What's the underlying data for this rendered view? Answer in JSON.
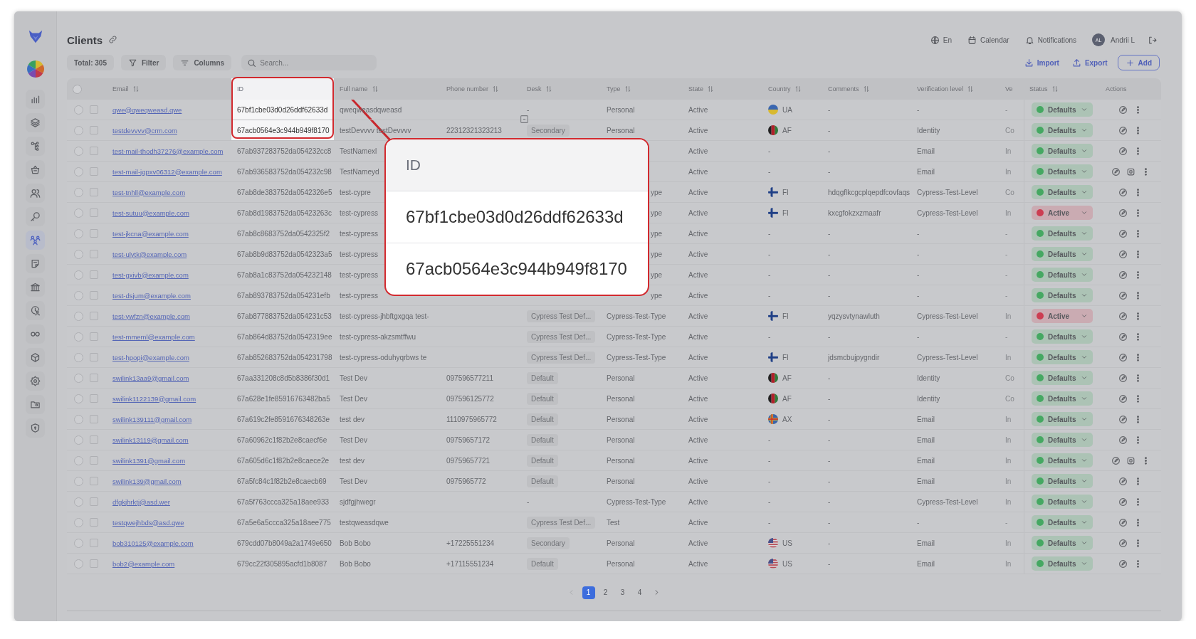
{
  "sidebar": {
    "items": [
      {
        "selected": false
      },
      {
        "selected": false
      },
      {
        "selected": false
      },
      {
        "selected": false
      },
      {
        "selected": false
      },
      {
        "selected": false
      },
      {
        "selected": true
      },
      {
        "selected": false
      },
      {
        "selected": false
      },
      {
        "selected": false
      },
      {
        "selected": false
      },
      {
        "selected": false
      },
      {
        "selected": false
      },
      {
        "selected": false
      },
      {
        "selected": false
      }
    ]
  },
  "header": {
    "title": "Clients",
    "language": "En",
    "calendar": "Calendar",
    "notifications": "Notifications",
    "avatar": "AL",
    "user": "Andrii L"
  },
  "toolbar": {
    "total": "Total: 305",
    "filter": "Filter",
    "columns": "Columns",
    "search": {
      "placeholder": "Search..."
    },
    "import": "Import",
    "export": "Export",
    "add": "Add"
  },
  "table": {
    "all_selected": false,
    "columns": [
      {
        "label": "Email",
        "sortable": true,
        "highlighted": false
      },
      {
        "label": "ID",
        "sortable": false,
        "highlighted": true
      },
      {
        "label": "Full name",
        "sortable": true,
        "highlighted": false
      },
      {
        "label": "Phone number",
        "sortable": true,
        "highlighted": false
      },
      {
        "label": "Desk",
        "sortable": true,
        "highlighted": false
      },
      {
        "label": "Type",
        "sortable": true,
        "highlighted": false
      },
      {
        "label": "State",
        "sortable": true,
        "highlighted": false
      },
      {
        "label": "Country",
        "sortable": true,
        "highlighted": false
      },
      {
        "label": "Comments",
        "sortable": true,
        "highlighted": false
      },
      {
        "label": "Verification level",
        "sortable": true,
        "highlighted": false
      },
      {
        "label": "Ve",
        "sortable": false,
        "highlighted": false
      },
      {
        "label": "Status",
        "sortable": true,
        "highlighted": false
      },
      {
        "label": "Actions",
        "sortable": false,
        "highlighted": false
      }
    ],
    "rows": [
      {
        "selected": false,
        "checked": false,
        "email": "qwe@qweqweasd.qwe",
        "id": "67bf1cbe03d0d26ddf62633d",
        "id_highlighted": true,
        "name": "qweqweasdqweasd",
        "desk": "-",
        "type": "Personal",
        "state": "Active",
        "country": "UA",
        "flag": {
          "kind": "ua"
        },
        "comments": "-",
        "verification": "-",
        "ver": "-",
        "status": {
          "label": "Defaults",
          "color": "#45a862"
        },
        "actions": [
          {
            "kind": "edit"
          },
          {
            "kind": "more"
          }
        ]
      },
      {
        "selected": false,
        "checked": false,
        "email": "testdevvvv@crm.com",
        "id": "67acb0564e3c944b949f8170",
        "id_highlighted": true,
        "name": "testDevvvv testDevvvv",
        "phone": "22312321323213",
        "desk_tag": "Secondary",
        "type": "Personal",
        "state": "Active",
        "country": "AF",
        "flag": {
          "kind": "af"
        },
        "comments": "-",
        "verification": "Identity",
        "ver": "Co",
        "status": {
          "label": "Defaults",
          "color": "#45a862"
        },
        "actions": [
          {
            "kind": "edit"
          },
          {
            "kind": "more"
          }
        ]
      },
      {
        "selected": false,
        "checked": false,
        "email": "test-mail-thodh37276@example.com",
        "id": "67ab937283752da054232cc8",
        "id_highlighted": false,
        "name": "TestNamexl",
        "state": "Active",
        "country": "-",
        "comments": "-",
        "verification": "Email",
        "ver": "In",
        "status": {
          "label": "Defaults",
          "color": "#45a862"
        },
        "actions": [
          {
            "kind": "edit"
          },
          {
            "kind": "more"
          }
        ]
      },
      {
        "selected": false,
        "checked": false,
        "email": "test-mail-jqpxv06312@example.com",
        "id": "67ab936583752da054232c98",
        "id_highlighted": false,
        "name": "TestNameyd",
        "state": "Active",
        "country": "-",
        "comments": "-",
        "verification": "Email",
        "ver": "In",
        "status": {
          "label": "Defaults",
          "color": "#45a862"
        },
        "actions": [
          {
            "kind": "edit"
          },
          {
            "kind": "copy"
          },
          {
            "kind": "more"
          }
        ]
      },
      {
        "selected": false,
        "checked": false,
        "email": "test-tnhll@example.com",
        "id": "67ab8de383752da0542326e5",
        "id_highlighted": false,
        "name": "test-cypre",
        "type_tail": "ype",
        "state": "Active",
        "country": "FI",
        "flag": {
          "kind": "fi"
        },
        "comments": "hdqgflkcgcplqepdfcovfaqs",
        "verification": "Cypress-Test-Level",
        "ver": "Co",
        "status": {
          "label": "Defaults",
          "color": "#45a862"
        },
        "actions": [
          {
            "kind": "edit"
          },
          {
            "kind": "more"
          }
        ]
      },
      {
        "selected": false,
        "checked": false,
        "email": "test-sutuu@example.com",
        "id": "67ab8d1983752da05423263c",
        "id_highlighted": false,
        "name": "test-cypress",
        "type_tail": "ype",
        "state": "Active",
        "country": "FI",
        "flag": {
          "kind": "fi"
        },
        "comments": "kxcgfokzxzmaafr",
        "verification": "Cypress-Test-Level",
        "ver": "In",
        "status": {
          "label": "Active",
          "color": "#cc3d52"
        },
        "actions": [
          {
            "kind": "edit"
          },
          {
            "kind": "more"
          }
        ]
      },
      {
        "selected": false,
        "checked": false,
        "email": "test-jkcna@example.com",
        "id": "67ab8c8683752da0542325f2",
        "id_highlighted": false,
        "name": "test-cypress",
        "type_tail": "ype",
        "state": "Active",
        "country": "-",
        "comments": "-",
        "verification": "-",
        "ver": "-",
        "status": {
          "label": "Defaults",
          "color": "#45a862"
        },
        "actions": [
          {
            "kind": "edit"
          },
          {
            "kind": "more"
          }
        ]
      },
      {
        "selected": false,
        "checked": false,
        "email": "test-ulytk@example.com",
        "id": "67ab8b9d83752da0542323a5",
        "id_highlighted": false,
        "name": "test-cypress",
        "type_tail": "ype",
        "state": "Active",
        "country": "-",
        "comments": "-",
        "verification": "-",
        "ver": "-",
        "status": {
          "label": "Defaults",
          "color": "#45a862"
        },
        "actions": [
          {
            "kind": "edit"
          },
          {
            "kind": "more"
          }
        ]
      },
      {
        "selected": false,
        "checked": false,
        "email": "test-gxivb@example.com",
        "id": "67ab8a1c83752da054232148",
        "id_highlighted": false,
        "name": "test-cypress",
        "type_tail": "ype",
        "state": "Active",
        "country": "-",
        "comments": "-",
        "verification": "-",
        "ver": "-",
        "status": {
          "label": "Defaults",
          "color": "#45a862"
        },
        "actions": [
          {
            "kind": "edit"
          },
          {
            "kind": "more"
          }
        ]
      },
      {
        "selected": false,
        "checked": false,
        "email": "test-dsjum@example.com",
        "id": "67ab893783752da054231efb",
        "id_highlighted": false,
        "name": "test-cypress",
        "type_tail": "ype",
        "state": "Active",
        "country": "-",
        "comments": "-",
        "verification": "-",
        "ver": "-",
        "status": {
          "label": "Defaults",
          "color": "#45a862"
        },
        "actions": [
          {
            "kind": "edit"
          },
          {
            "kind": "more"
          }
        ]
      },
      {
        "selected": false,
        "checked": false,
        "email": "test-ywfzn@example.com",
        "id": "67ab877883752da054231c53",
        "id_highlighted": false,
        "name": "test-cypress-jhbftgxgqa test-",
        "desk_tag": "Cypress Test Def...",
        "type": "Cypress-Test-Type",
        "state": "Active",
        "country": "FI",
        "flag": {
          "kind": "fi"
        },
        "comments": "yqzysvtynawluth",
        "verification": "Cypress-Test-Level",
        "ver": "In",
        "status": {
          "label": "Active",
          "color": "#cc3d52"
        },
        "actions": [
          {
            "kind": "edit"
          },
          {
            "kind": "more"
          }
        ]
      },
      {
        "selected": false,
        "checked": false,
        "email": "test-mmeml@example.com",
        "id": "67ab864d83752da0542319ee",
        "id_highlighted": false,
        "name": "test-cypress-akzsmtffwu",
        "desk_tag": "Cypress Test Def...",
        "type": "Cypress-Test-Type",
        "state": "Active",
        "country": "-",
        "comments": "-",
        "verification": "-",
        "ver": "-",
        "status": {
          "label": "Defaults",
          "color": "#45a862"
        },
        "actions": [
          {
            "kind": "edit"
          },
          {
            "kind": "more"
          }
        ]
      },
      {
        "selected": false,
        "checked": false,
        "email": "test-hpopi@example.com",
        "id": "67ab852683752da054231798",
        "id_highlighted": false,
        "name": "test-cypress-oduhyqrbws te",
        "desk_tag": "Cypress Test Def...",
        "type": "Cypress-Test-Type",
        "state": "Active",
        "country": "FI",
        "flag": {
          "kind": "fi"
        },
        "comments": "jdsmcbujpygndir",
        "verification": "Cypress-Test-Level",
        "ver": "In",
        "status": {
          "label": "Defaults",
          "color": "#45a862"
        },
        "actions": [
          {
            "kind": "edit"
          },
          {
            "kind": "more"
          }
        ]
      },
      {
        "selected": false,
        "checked": false,
        "email": "swilink13aa9@gmail.com",
        "id": "67aa331208c8d5b8386f30d1",
        "id_highlighted": false,
        "name": "Test Dev",
        "phone": "097596577211",
        "desk_tag": "Default",
        "type": "Personal",
        "state": "Active",
        "country": "AF",
        "flag": {
          "kind": "af"
        },
        "comments": "-",
        "verification": "Identity",
        "ver": "Co",
        "status": {
          "label": "Defaults",
          "color": "#45a862"
        },
        "actions": [
          {
            "kind": "edit"
          },
          {
            "kind": "more"
          }
        ]
      },
      {
        "selected": false,
        "checked": false,
        "email": "swilink1122139@gmail.com",
        "id": "67a628e1fe85916763482ba5",
        "id_highlighted": false,
        "name": "Test Dev",
        "phone": "097596125772",
        "desk_tag": "Default",
        "type": "Personal",
        "state": "Active",
        "country": "AF",
        "flag": {
          "kind": "af"
        },
        "comments": "-",
        "verification": "Identity",
        "ver": "Co",
        "status": {
          "label": "Defaults",
          "color": "#45a862"
        },
        "actions": [
          {
            "kind": "edit"
          },
          {
            "kind": "more"
          }
        ]
      },
      {
        "selected": false,
        "checked": false,
        "email": "swilink139111@gmail.com",
        "id": "67a619c2fe8591676348263e",
        "id_highlighted": false,
        "name": "test dev",
        "phone": "1110975965772",
        "desk_tag": "Default",
        "type": "Personal",
        "state": "Active",
        "country": "AX",
        "flag": {
          "kind": "ax"
        },
        "comments": "-",
        "verification": "Email",
        "ver": "In",
        "status": {
          "label": "Defaults",
          "color": "#45a862"
        },
        "actions": [
          {
            "kind": "edit"
          },
          {
            "kind": "more"
          }
        ]
      },
      {
        "selected": false,
        "checked": false,
        "email": "swilink13119@gmail.com",
        "id": "67a60962c1f82b2e8caecf6e",
        "id_highlighted": false,
        "name": "Test Dev",
        "phone": "09759657172",
        "desk_tag": "Default",
        "type": "Personal",
        "state": "Active",
        "country": "-",
        "comments": "-",
        "verification": "Email",
        "ver": "In",
        "status": {
          "label": "Defaults",
          "color": "#45a862"
        },
        "actions": [
          {
            "kind": "edit"
          },
          {
            "kind": "more"
          }
        ]
      },
      {
        "selected": false,
        "checked": false,
        "email": "swilink1391@gmail.com",
        "id": "67a605d6c1f82b2e8caece2e",
        "id_highlighted": false,
        "name": "test dev",
        "phone": "09759657721",
        "desk_tag": "Default",
        "type": "Personal",
        "state": "Active",
        "country": "-",
        "comments": "-",
        "verification": "Email",
        "ver": "In",
        "status": {
          "label": "Defaults",
          "color": "#45a862"
        },
        "actions": [
          {
            "kind": "edit"
          },
          {
            "kind": "copy"
          },
          {
            "kind": "more"
          }
        ]
      },
      {
        "selected": false,
        "checked": false,
        "email": "swilink139@gmail.com",
        "id": "67a5fc84c1f82b2e8caecb69",
        "id_highlighted": false,
        "name": "Test Dev",
        "phone": "0975965772",
        "desk_tag": "Default",
        "type": "Personal",
        "state": "Active",
        "country": "-",
        "comments": "-",
        "verification": "Email",
        "ver": "In",
        "status": {
          "label": "Defaults",
          "color": "#45a862"
        },
        "actions": [
          {
            "kind": "edit"
          },
          {
            "kind": "more"
          }
        ]
      },
      {
        "selected": false,
        "checked": false,
        "email": "dfgkjhrktj@asd.wer",
        "id": "67a5f763ccca325a18aee933",
        "id_highlighted": false,
        "name": "sjdfgjhwegr",
        "desk": "-",
        "type": "Cypress-Test-Type",
        "state": "Active",
        "country": "-",
        "comments": "-",
        "verification": "Cypress-Test-Level",
        "ver": "In",
        "status": {
          "label": "Defaults",
          "color": "#45a862"
        },
        "actions": [
          {
            "kind": "edit"
          },
          {
            "kind": "more"
          }
        ]
      },
      {
        "selected": false,
        "checked": false,
        "email": "testqwejhbds@asd.qwe",
        "id": "67a5e6a5ccca325a18aee775",
        "id_highlighted": false,
        "name": "testqweasdqwe",
        "desk_tag": "Cypress Test Def...",
        "type": "Test",
        "state": "Active",
        "country": "-",
        "comments": "-",
        "verification": "-",
        "ver": "-",
        "status": {
          "label": "Defaults",
          "color": "#45a862"
        },
        "actions": [
          {
            "kind": "edit"
          },
          {
            "kind": "more"
          }
        ]
      },
      {
        "selected": false,
        "checked": false,
        "email": "bob310125@example.com",
        "id": "679cdd07b8049a2a1749e650",
        "id_highlighted": false,
        "name": "Bob Bobo",
        "phone": "+17225551234",
        "desk_tag": "Secondary",
        "type": "Personal",
        "state": "Active",
        "country": "US",
        "flag": {
          "kind": "us"
        },
        "comments": "-",
        "verification": "Email",
        "ver": "In",
        "status": {
          "label": "Defaults",
          "color": "#45a862"
        },
        "actions": [
          {
            "kind": "edit"
          },
          {
            "kind": "more"
          }
        ]
      },
      {
        "selected": false,
        "checked": false,
        "email": "bob2@example.com",
        "id": "679cc22f305895acfd1b8087",
        "id_highlighted": false,
        "name": "Bob Bobo",
        "phone": "+17115551234",
        "desk_tag": "Default",
        "type": "Personal",
        "state": "Active",
        "country": "US",
        "flag": {
          "kind": "us"
        },
        "comments": "-",
        "verification": "Email",
        "ver": "In",
        "status": {
          "label": "Defaults",
          "color": "#45a862"
        },
        "actions": [
          {
            "kind": "edit"
          },
          {
            "kind": "more"
          }
        ]
      }
    ]
  },
  "callout": {
    "header": "ID",
    "values": [
      "67bf1cbe03d0d26ddf62633d",
      "67acb0564e3c944b949f8170"
    ]
  },
  "pagination": {
    "prev": {
      "disabled": true
    },
    "pages": [
      {
        "label": "1",
        "selected": true
      },
      {
        "label": "2",
        "selected": false
      },
      {
        "label": "3",
        "selected": false
      },
      {
        "label": "4",
        "selected": false
      }
    ],
    "next": {
      "disabled": false
    }
  }
}
